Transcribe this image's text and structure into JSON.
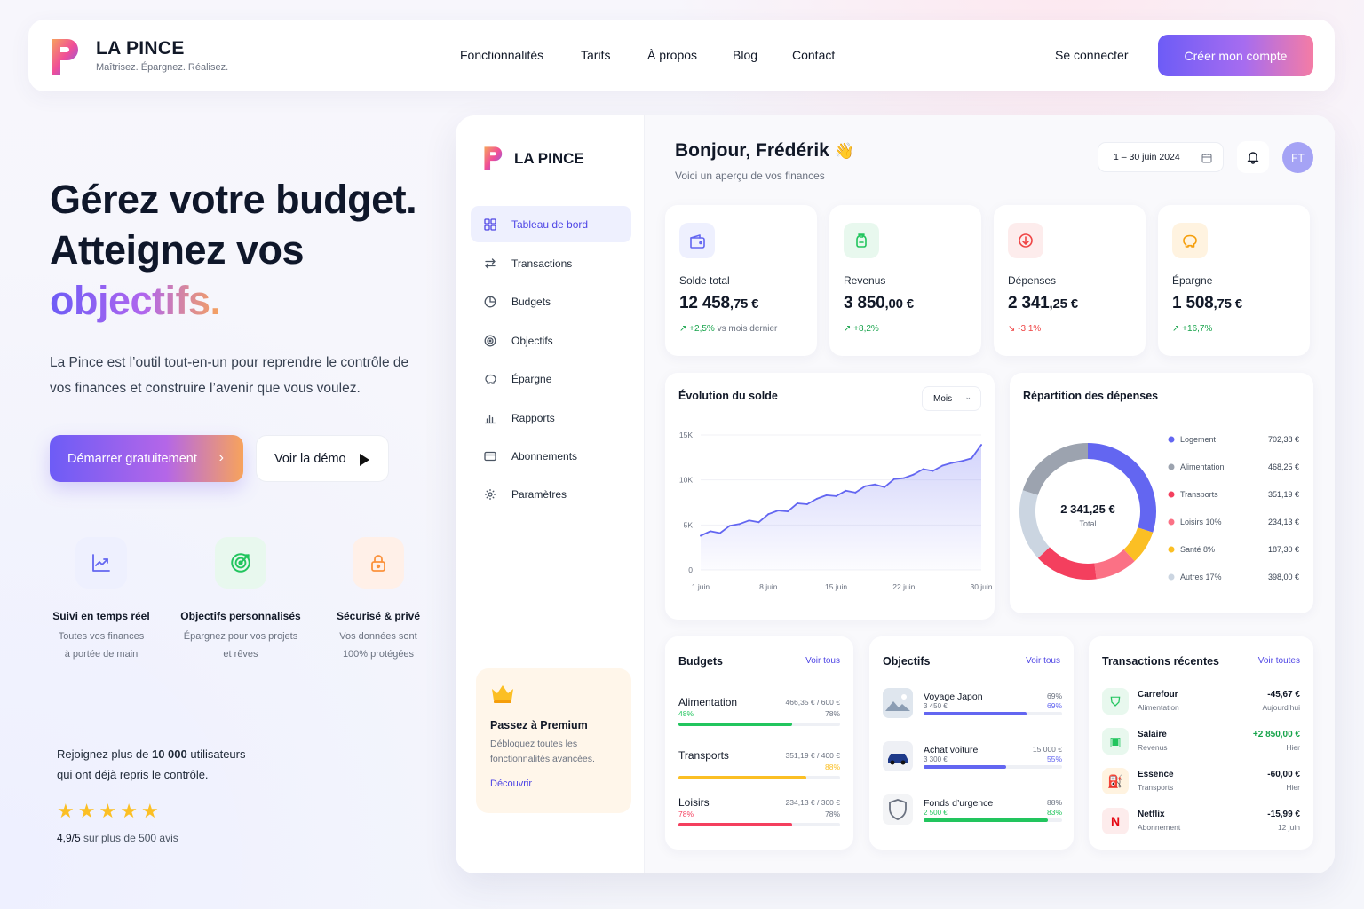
{
  "brand": {
    "name": "LA PINCE",
    "tagline": "Maîtrisez. Épargnez. Réalisez."
  },
  "nav": {
    "links": [
      "Fonctionnalités",
      "Tarifs",
      "À propos",
      "Blog",
      "Contact"
    ],
    "login": "Se connecter",
    "signup": "Créer mon compte"
  },
  "hero": {
    "line1": "Gérez votre budget.",
    "line2": "Atteignez vos",
    "line3": "objectifs.",
    "lead": "La Pince est l’outil tout-en-un pour reprendre le contrôle de vos finances et construire l’avenir que vous voulez.",
    "cta_primary": "Démarrer gratuitement",
    "cta_demo": "Voir la démo"
  },
  "features": [
    {
      "title": "Suivi en temps réel",
      "line1": "Toutes vos finances",
      "line2": "à portée de main",
      "icon": "chart-up-icon"
    },
    {
      "title": "Objectifs personnalisés",
      "line1": "Épargnez pour vos projets",
      "line2": "et rêves",
      "icon": "target-icon"
    },
    {
      "title": "Sécurisé & privé",
      "line1": "Vos données sont",
      "line2": "100% protégées",
      "icon": "lock-icon"
    }
  ],
  "social": {
    "line1_pre": "Rejoignez plus de ",
    "line1_bold": "10 000",
    "line1_post": " utilisateurs",
    "line2": "qui ont déjà repris le contrôle.",
    "rating_bold": "4,9/5",
    "rating_rest": " sur plus de 500 avis",
    "stars": 5
  },
  "dashboard": {
    "brand": "LA PINCE",
    "greeting": "Bonjour, Frédérik",
    "wave": "👋",
    "subtitle": "Voici un aperçu de vos finances",
    "date_range": "1 – 30 juin 2024",
    "avatar": "FT",
    "sidebar": [
      {
        "label": "Tableau de bord",
        "active": true,
        "icon": "grid-icon"
      },
      {
        "label": "Transactions",
        "active": false,
        "icon": "arrows-icon"
      },
      {
        "label": "Budgets",
        "active": false,
        "icon": "pie-icon"
      },
      {
        "label": "Objectifs",
        "active": false,
        "icon": "target-icon"
      },
      {
        "label": "Épargne",
        "active": false,
        "icon": "piggy-icon"
      },
      {
        "label": "Rapports",
        "active": false,
        "icon": "bar-chart-icon"
      },
      {
        "label": "Abonnements",
        "active": false,
        "icon": "card-icon"
      },
      {
        "label": "Paramètres",
        "active": false,
        "icon": "gear-icon"
      }
    ],
    "premium": {
      "title": "Passez à Premium",
      "line1": "Débloquez toutes les",
      "line2": "fonctionnalités avancées.",
      "link": "Découvrir"
    },
    "kpis": [
      {
        "label": "Solde total",
        "int": "12 458",
        "dec": ",75 €",
        "change": "+2,5%",
        "note": " vs mois dernier",
        "dir": "up",
        "color": "#6366f1",
        "bg": "#eef0fe",
        "icon": "wallet-icon"
      },
      {
        "label": "Revenus",
        "int": "3 850",
        "dec": ",00 €",
        "change": "+8,2%",
        "note": "",
        "dir": "up",
        "color": "#22c55e",
        "bg": "#e8f8ee",
        "icon": "money-bag-icon"
      },
      {
        "label": "Dépenses",
        "int": "2 341",
        "dec": ",25 €",
        "change": "-3,1%",
        "note": "",
        "dir": "down",
        "color": "#ef4444",
        "bg": "#fdecec",
        "icon": "arrow-down-circle-icon"
      },
      {
        "label": "Épargne",
        "int": "1 508",
        "dec": ",75 €",
        "change": "+16,7%",
        "note": "",
        "dir": "up",
        "color": "#f59e0b",
        "bg": "#fff3e0",
        "icon": "piggy-icon"
      }
    ],
    "chart": {
      "title": "Évolution du solde",
      "period": "Mois"
    },
    "donut": {
      "title": "Répartition des dépenses",
      "total": "2 341,25 €",
      "total_label": "Total"
    },
    "budgets": {
      "title": "Budgets",
      "link": "Voir tous",
      "items": [
        {
          "name": "Alimentation",
          "amount": "466,35 € / 600 €",
          "pct": "78%",
          "pct_left": "48%",
          "fill": 0.78,
          "color": "#22c55e"
        },
        {
          "name": "Transports",
          "amount": "351,19 € / 400 €",
          "pct": "88%",
          "pct_left": "",
          "fill": 0.88,
          "color": "#fbbf24"
        },
        {
          "name": "Loisirs",
          "amount": "234,13 € / 300 €",
          "pct": "78%",
          "pct_left": "78%",
          "fill": 0.78,
          "color": "#f43f5e"
        }
      ]
    },
    "goals": {
      "title": "Objectifs",
      "link": "Voir tous",
      "items": [
        {
          "name": "Voyage Japon",
          "sub": "3 450 €",
          "right": "69%",
          "right2": "69%",
          "fill": 0.69,
          "color": "#6366f1",
          "icon": "mountain-photo-icon"
        },
        {
          "name": "Achat voiture",
          "sub": "3 300 €",
          "right": "15 000 €",
          "right2": "55%",
          "fill": 0.55,
          "color": "#6366f1",
          "icon": "car-icon"
        },
        {
          "name": "Fonds d’urgence",
          "sub": "2 500 €",
          "right": "88%",
          "right2": "83%",
          "fill": 0.83,
          "color": "#22c55e",
          "icon": "shield-icon"
        }
      ]
    },
    "transactions": {
      "title": "Transactions récentes",
      "link": "Voir toutes",
      "items": [
        {
          "name": "Carrefour",
          "cat": "Alimentation",
          "amount": "-45,67 €",
          "when": "Aujourd’hui",
          "positive": false,
          "icon": "basket-icon",
          "bg": "#e8f8ee",
          "fg": "#22c55e"
        },
        {
          "name": "Salaire",
          "cat": "Revenus",
          "amount": "+2 850,00 €",
          "when": "Hier",
          "positive": true,
          "icon": "money-icon",
          "bg": "#e8f8ee",
          "fg": "#22c55e"
        },
        {
          "name": "Essence",
          "cat": "Transports",
          "amount": "-60,00 €",
          "when": "Hier",
          "positive": false,
          "icon": "fuel-icon",
          "bg": "#fff3e0",
          "fg": "#f59e0b"
        },
        {
          "name": "Netflix",
          "cat": "Abonnement",
          "amount": "-15,99 €",
          "when": "12 juin",
          "positive": false,
          "icon": "netflix-icon",
          "bg": "#fdecec",
          "fg": "#e50914"
        }
      ]
    }
  },
  "chart_data": [
    {
      "type": "area",
      "title": "Évolution du solde",
      "x_ticks": [
        "1 juin",
        "8 juin",
        "15 juin",
        "22 juin",
        "30 juin"
      ],
      "y_ticks": [
        "0",
        "5K",
        "10K",
        "15K"
      ],
      "ylim": [
        0,
        15000
      ],
      "x": [
        1,
        2,
        3,
        4,
        5,
        6,
        7,
        8,
        9,
        10,
        11,
        12,
        13,
        14,
        15,
        16,
        17,
        18,
        19,
        20,
        21,
        22,
        23,
        24,
        25,
        26,
        27,
        28,
        29,
        30
      ],
      "values": [
        3800,
        4300,
        4100,
        4900,
        5100,
        5500,
        5300,
        6200,
        6600,
        6500,
        7400,
        7300,
        7900,
        8300,
        8200,
        8800,
        8600,
        9300,
        9500,
        9200,
        10100,
        10200,
        10600,
        11200,
        11000,
        11600,
        11900,
        12100,
        12400,
        13900
      ],
      "color": "#6366f1"
    },
    {
      "type": "pie",
      "title": "Répartition des dépenses",
      "labels": [
        "Logement",
        "Alimentation",
        "Transports",
        "Loisirs 10%",
        "Santé 8%",
        "Autres 17%"
      ],
      "values": [
        702.38,
        468.25,
        351.19,
        234.13,
        187.3,
        398.0
      ],
      "value_labels": [
        "702,38 €",
        "468,25 €",
        "351,19 €",
        "234,13 €",
        "187,30 €",
        "398,00 €"
      ],
      "colors": [
        "#6366f1",
        "#9ca3af",
        "#f43f5e",
        "#fb7185",
        "#fbbf24",
        "#cbd5e1"
      ],
      "donut_order": [
        0,
        4,
        3,
        2,
        5,
        1
      ]
    }
  ]
}
